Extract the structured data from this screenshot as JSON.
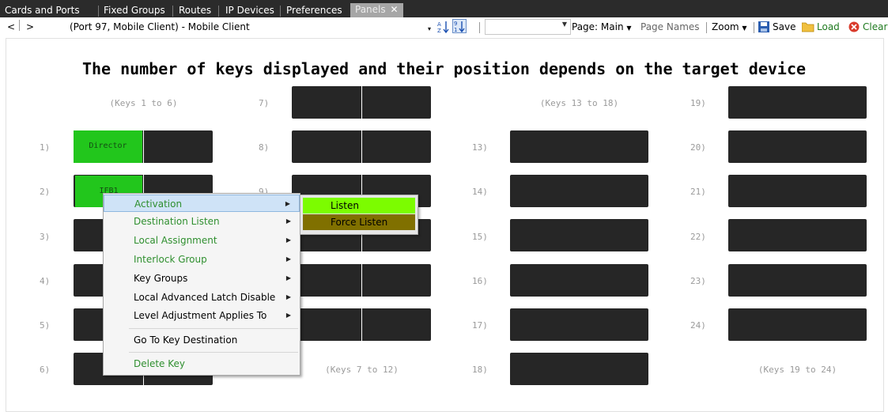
{
  "tabs": [
    {
      "label": "Cards and Ports"
    },
    {
      "label": "Fixed Groups"
    },
    {
      "label": "Routes"
    },
    {
      "label": "IP Devices"
    },
    {
      "label": "Preferences"
    },
    {
      "label": "Panels",
      "close": "✕"
    }
  ],
  "toolbar": {
    "back": "<",
    "forward": ">",
    "port_info": "(Port 97, Mobile Client)  -  Mobile Client",
    "sort_asc_icon": "sort-az-icon",
    "sort_desc_icon": "sort-91-icon",
    "combo_value": "",
    "page": "Page: Main",
    "page_names": "Page Names",
    "zoom": "Zoom",
    "save": "Save",
    "load": "Load",
    "clear": "Clear"
  },
  "heading": "The number of keys displayed and their position depends on the target device",
  "captions": {
    "keys_1_6": "(Keys 1 to 6)",
    "keys_7_12": "(Keys 7 to 12)",
    "keys_13_18": "(Keys 13 to 18)",
    "keys_19_24": "(Keys 19 to 24)"
  },
  "key_labels": {
    "k1": "1)",
    "k2": "2)",
    "k3": "3)",
    "k4": "4)",
    "k5": "5)",
    "k6": "6)",
    "k7": "7)",
    "k8": "8)",
    "k9": "9)",
    "k13": "13)",
    "k14": "14)",
    "k15": "15)",
    "k16": "16)",
    "k17": "17)",
    "k18": "18)",
    "k19": "19)",
    "k20": "20)",
    "k21": "21)",
    "k22": "22)",
    "k23": "23)",
    "k24": "24)"
  },
  "assigned_keys": {
    "key1": "Director",
    "key2": "IFB1"
  },
  "context_menu": {
    "activation": "Activation",
    "destination_listen": "Destination Listen",
    "local_assignment": "Local Assignment",
    "interlock_group": "Interlock Group",
    "key_groups": "Key Groups",
    "local_advanced_latch_disable": "Local Advanced Latch Disable",
    "level_adjustment_applies_to": "Level Adjustment Applies To",
    "go_to_key_destination": "Go To Key Destination",
    "delete_key": "Delete Key"
  },
  "submenu": {
    "listen": "Listen",
    "force_listen": "Force Listen"
  },
  "colors": {
    "assigned_key": "#22c61c",
    "empty_key": "#262626",
    "menu_green_text": "#2f8f2f",
    "listen_bg": "#7cfc00",
    "force_listen_bg": "#807000",
    "tabbar_bg": "#2b2b2b"
  }
}
